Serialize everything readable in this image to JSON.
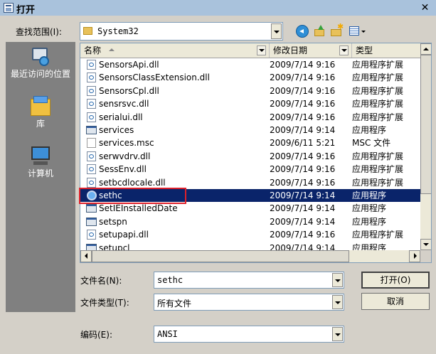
{
  "window": {
    "title": "打开",
    "close_glyph": "✕"
  },
  "lookin": {
    "label": "查找范围(I):",
    "value": "System32"
  },
  "places": [
    {
      "label": "最近访问的位置",
      "icon": "recent-places-icon"
    },
    {
      "label": "库",
      "icon": "library-icon"
    },
    {
      "label": "计算机",
      "icon": "computer-icon"
    }
  ],
  "columns": {
    "name": "名称",
    "date": "修改日期",
    "type": "类型"
  },
  "files": [
    {
      "name": "SensorsApi.dll",
      "date": "2009/7/14 9:16",
      "type": "应用程序扩展",
      "icon": "dll"
    },
    {
      "name": "SensorsClassExtension.dll",
      "date": "2009/7/14 9:16",
      "type": "应用程序扩展",
      "icon": "dll"
    },
    {
      "name": "SensorsCpl.dll",
      "date": "2009/7/14 9:16",
      "type": "应用程序扩展",
      "icon": "dll"
    },
    {
      "name": "sensrsvc.dll",
      "date": "2009/7/14 9:16",
      "type": "应用程序扩展",
      "icon": "dll"
    },
    {
      "name": "serialui.dll",
      "date": "2009/7/14 9:16",
      "type": "应用程序扩展",
      "icon": "dll"
    },
    {
      "name": "services",
      "date": "2009/7/14 9:14",
      "type": "应用程序",
      "icon": "app"
    },
    {
      "name": "services.msc",
      "date": "2009/6/11 5:21",
      "type": "MSC 文件",
      "icon": "doc"
    },
    {
      "name": "serwvdrv.dll",
      "date": "2009/7/14 9:16",
      "type": "应用程序扩展",
      "icon": "dll"
    },
    {
      "name": "SessEnv.dll",
      "date": "2009/7/14 9:16",
      "type": "应用程序扩展",
      "icon": "dll"
    },
    {
      "name": "setbcdlocale.dll",
      "date": "2009/7/14 9:16",
      "type": "应用程序扩展",
      "icon": "dll"
    },
    {
      "name": "sethc",
      "date": "2009/7/14 9:14",
      "type": "应用程序",
      "icon": "sethc",
      "selected": true
    },
    {
      "name": "SetIEInstalledDate",
      "date": "2009/7/14 9:14",
      "type": "应用程序",
      "icon": "app"
    },
    {
      "name": "setspn",
      "date": "2009/7/14 9:14",
      "type": "应用程序",
      "icon": "app"
    },
    {
      "name": "setupapi.dll",
      "date": "2009/7/14 9:16",
      "type": "应用程序扩展",
      "icon": "dll"
    },
    {
      "name": "setupcl",
      "date": "2009/7/14 9:14",
      "type": "应用程序",
      "icon": "app"
    }
  ],
  "filename": {
    "label": "文件名(N):",
    "value": "sethc"
  },
  "filetype": {
    "label": "文件类型(T):",
    "value": "所有文件"
  },
  "encoding": {
    "label": "编码(E):",
    "value": "ANSI"
  },
  "buttons": {
    "open": "打开(O)",
    "cancel": "取消"
  },
  "colors": {
    "selection": "#0a246a",
    "highlight_box": "#e0202a",
    "places_bar": "#808080"
  }
}
